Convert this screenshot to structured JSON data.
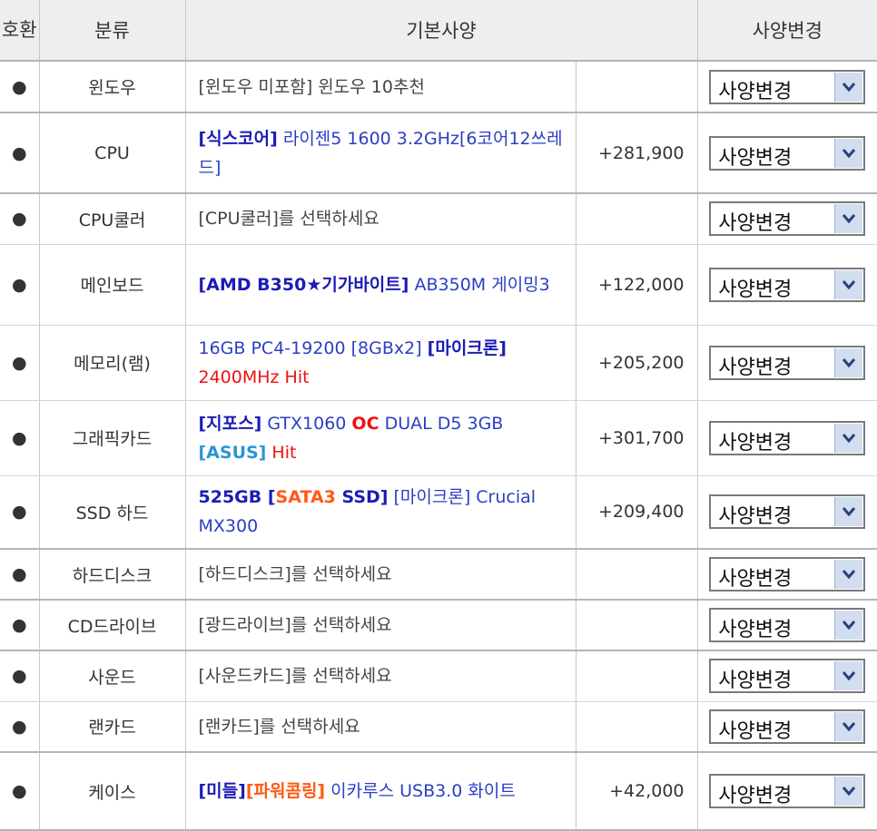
{
  "headers": {
    "compat": "호환",
    "category": "분류",
    "spec": "기본사양",
    "change": "사양변경"
  },
  "select_label": "사양변경",
  "bullet": "●",
  "rows": [
    {
      "category": "윈도우",
      "price": "",
      "parts": [
        {
          "t": "[윈도우 미포함] 윈도우 10추천",
          "s": "gray"
        }
      ]
    },
    {
      "category": "CPU",
      "price": "+281,900",
      "parts": [
        {
          "t": "[식스코어]",
          "s": "b-blue"
        },
        {
          "t": " 라이젠5 1600 3.2GHz[6코어12쓰레드]",
          "s": "blue"
        }
      ]
    },
    {
      "category": "CPU쿨러",
      "price": "",
      "parts": [
        {
          "t": "[CPU쿨러]를 선택하세요",
          "s": "gray"
        }
      ]
    },
    {
      "category": "메인보드",
      "price": "+122,000",
      "parts": [
        {
          "t": "[AMD B350★기가바이트]",
          "s": "b-blue"
        },
        {
          "t": " AB350M 게이밍3",
          "s": "blue"
        }
      ]
    },
    {
      "category": "메모리(램)",
      "price": "+205,200",
      "parts": [
        {
          "t": "16GB PC4-19200 [8GBx2] ",
          "s": "blue"
        },
        {
          "t": "[마이크론]",
          "s": "b-blue"
        },
        {
          "t": " 2400MHz Hit",
          "s": "red"
        }
      ]
    },
    {
      "category": "그래픽카드",
      "price": "+301,700",
      "parts": [
        {
          "t": "[지포스]",
          "s": "b-blue"
        },
        {
          "t": " GTX1060 ",
          "s": "blue"
        },
        {
          "t": "OC",
          "s": "b-red"
        },
        {
          "t": " DUAL D5 3GB ",
          "s": "blue"
        },
        {
          "t": "[ASUS]",
          "s": "b-cyan"
        },
        {
          "t": " Hit",
          "s": "red"
        }
      ]
    },
    {
      "category": "SSD 하드",
      "price": "+209,400",
      "parts": [
        {
          "t": "525GB [",
          "s": "b-blue"
        },
        {
          "t": "SATA3",
          "s": "b-orange"
        },
        {
          "t": " SSD]",
          "s": "b-blue"
        },
        {
          "t": " [마이크론] Crucial MX300",
          "s": "blue"
        }
      ]
    },
    {
      "category": "하드디스크",
      "price": "",
      "parts": [
        {
          "t": "[하드디스크]를 선택하세요",
          "s": "gray"
        }
      ]
    },
    {
      "category": "CD드라이브",
      "price": "",
      "parts": [
        {
          "t": "[광드라이브]를 선택하세요",
          "s": "gray"
        }
      ]
    },
    {
      "category": "사운드",
      "price": "",
      "parts": [
        {
          "t": "[사운드카드]를 선택하세요",
          "s": "gray"
        }
      ]
    },
    {
      "category": "랜카드",
      "price": "",
      "parts": [
        {
          "t": "[랜카드]를 선택하세요",
          "s": "gray"
        }
      ]
    },
    {
      "category": "케이스",
      "price": "+42,000",
      "parts": [
        {
          "t": "[미들]",
          "s": "b-blue"
        },
        {
          "t": "[파워콤링]",
          "s": "b-orange"
        },
        {
          "t": " 이카루스 USB3.0 화이트",
          "s": "blue"
        }
      ]
    }
  ]
}
